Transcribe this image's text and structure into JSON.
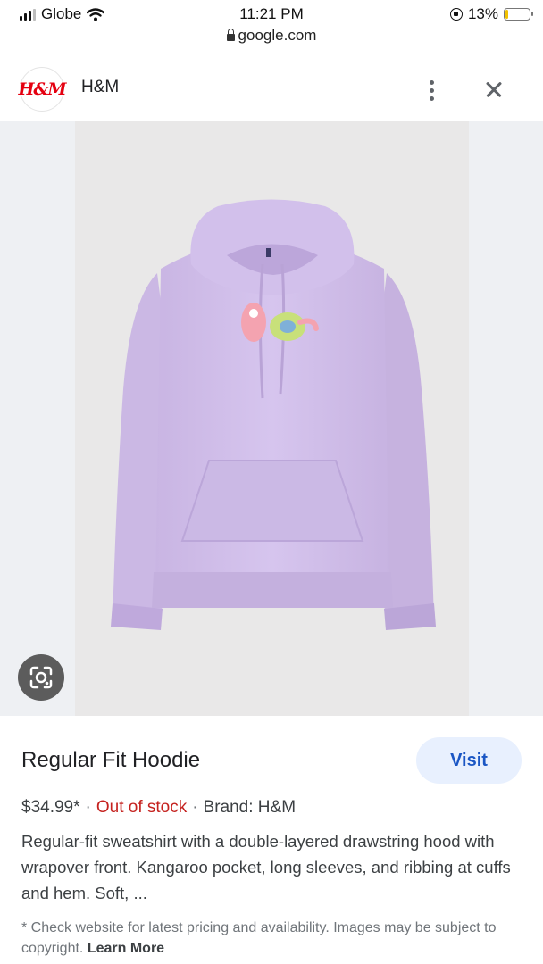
{
  "status_bar": {
    "carrier": "Globe",
    "time": "11:21 PM",
    "url": "google.com",
    "battery_percent": "13%",
    "battery_level": 0.13,
    "icons": [
      "signal-bars-icon",
      "wifi-icon",
      "orientation-lock-icon",
      "battery-icon",
      "lock-icon"
    ]
  },
  "header": {
    "logo_text": "H&M",
    "brand_name": "H&M",
    "icons": [
      "more-vert-icon",
      "close-icon"
    ]
  },
  "image": {
    "lens_icon": "google-lens-icon"
  },
  "product": {
    "title": "Regular Fit Hoodie",
    "visit_label": "Visit",
    "price": "$34.99*",
    "separator": "·",
    "stock_status": "Out of stock",
    "brand": "Brand: H&M",
    "description": "Regular-fit sweatshirt with a double-layered drawstring hood with wrapover front. Kangaroo pocket, long sleeves, and ribbing at cuffs and hem. Soft, ...",
    "disclaimer": "* Check website for latest pricing and availability. Images may be subject to copyright.",
    "learn_more": "Learn More"
  },
  "colors": {
    "stock_status": "#c5221f",
    "visit_button_bg": "#e8f0fe",
    "visit_button_text": "#1a56c4",
    "hoodie": "#d4c2ec",
    "brand_red": "#e50010"
  }
}
